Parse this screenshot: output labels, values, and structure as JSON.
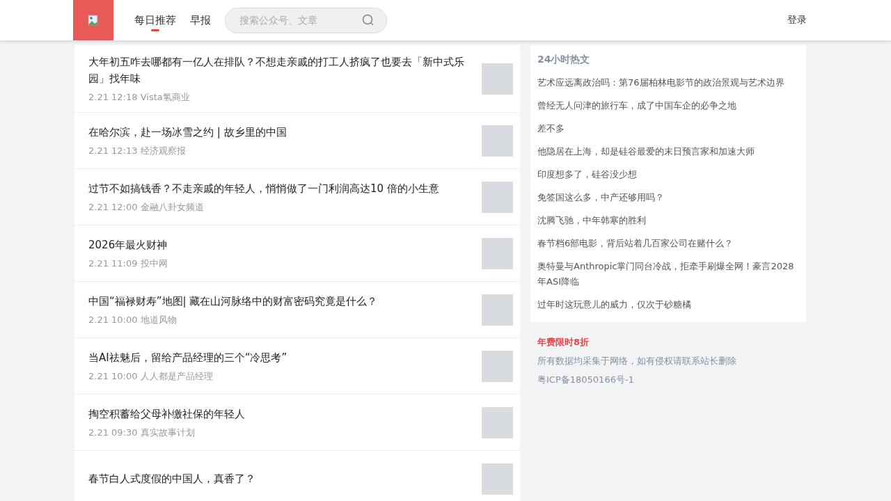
{
  "header": {
    "nav": [
      {
        "label": "每日推荐",
        "selected": true
      },
      {
        "label": "早报",
        "selected": false
      }
    ],
    "search": {
      "placeholder": "搜索公众号、文章"
    },
    "login": "登录"
  },
  "articles": [
    {
      "title": "大年初五咋去哪都有一亿人在排队？不想走亲戚的打工人挤疯了也要去「新中式乐园」找年味",
      "meta": "2.21 12:18 Vista氢商业"
    },
    {
      "title": "在哈尔滨，赴一场冰雪之约 | 故乡里的中国",
      "meta": "2.21 12:13 经济观察报"
    },
    {
      "title": "过节不如搞钱香？不走亲戚的年轻人，悄悄做了一门利润高达10 倍的小生意",
      "meta": "2.21 12:00 金融八卦女频道"
    },
    {
      "title": "2026年最火财神",
      "meta": "2.21 11:09 投中网"
    },
    {
      "title": "中国“福禄财寿”地图| 藏在山河脉络中的财富密码究竟是什么？",
      "meta": "2.21 10:00 地道风物"
    },
    {
      "title": "当AI祛魅后，留给产品经理的三个“冷思考”",
      "meta": "2.21 10:00 人人都是产品经理"
    },
    {
      "title": "掏空积蓄给父母补缴社保的年轻人",
      "meta": "2.21 09:30 真实故事计划"
    },
    {
      "title": "春节白人式度假的中国人，真香了？"
    }
  ],
  "hot": {
    "title": "24小时热文",
    "items": [
      "艺术应远离政治吗：第76届柏林电影节的政治景观与艺术边界",
      "曾经无人问津的旅行车，成了中国车企的必争之地",
      "差不多",
      "他隐居在上海，却是硅谷最爱的末日预言家和加速大师",
      "印度想多了，硅谷没少想",
      "免签国这么多，中产还够用吗？",
      "沈腾飞驰，中年韩寒的胜利",
      "春节档6部电影，背后站着几百家公司在赌什么？",
      "奥特曼与Anthropic掌门同台冷战，拒牵手刷爆全网！豪言2028年ASI降临",
      "过年时这玩意儿的威力，仅次于砂糖橘"
    ]
  },
  "footer": {
    "promo": "年费限时8折",
    "notice": "所有数据均采集于网络，如有侵权请联系站长删除",
    "icp": "粤ICP备18050166号-1"
  }
}
